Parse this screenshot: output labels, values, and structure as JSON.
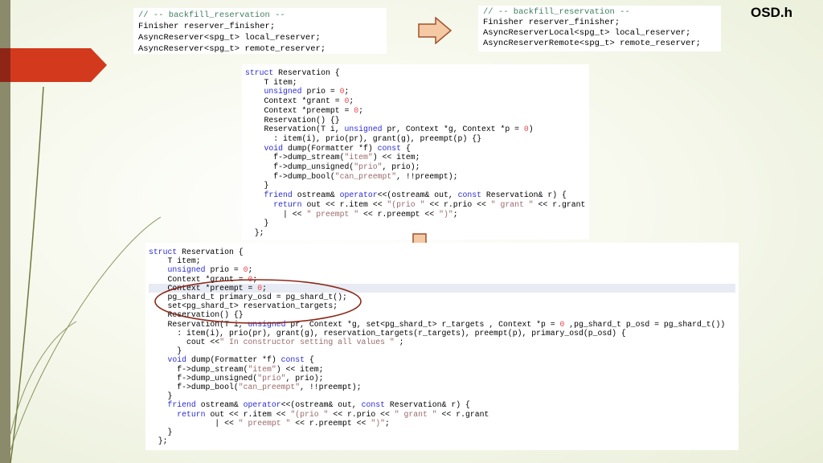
{
  "slide": {
    "title": "OSD.h"
  },
  "colors": {
    "comment": "#3f7f5f",
    "keyword": "#2a2ad4",
    "number": "#e8474a",
    "string": "#9a6a6a",
    "ribbon": "#d3391d",
    "ellipse": "#8b2a1a",
    "arrow_fill": "#f4c9a4",
    "arrow_stroke": "#a0522d"
  },
  "icons": {
    "right_arrow": "right-arrow-icon",
    "down_arrow": "down-arrow-icon"
  },
  "code_before": [
    [
      [
        "c",
        "// -- backfill_reservation --"
      ]
    ],
    [
      [
        "p",
        "Finisher reserver_finisher;"
      ]
    ],
    [
      [
        "p",
        "AsyncReserver<spg_t> local_reserver;"
      ]
    ],
    [
      [
        "p",
        "AsyncReserver<spg_t> remote_reserver;"
      ]
    ]
  ],
  "code_after": [
    [
      [
        "c",
        "// -- backfill_reservation --"
      ]
    ],
    [
      [
        "p",
        "Finisher reserver_finisher;"
      ]
    ],
    [
      [
        "p",
        "AsyncReserverLocal<spg_t> local_reserver;"
      ]
    ],
    [
      [
        "p",
        "AsyncReserverRemote<spg_t> remote_reserver;"
      ]
    ]
  ],
  "code_struct_original": [
    [
      [
        "k",
        "struct"
      ],
      [
        "p",
        " Reservation {"
      ]
    ],
    [
      [
        "p",
        "    T item;"
      ]
    ],
    [
      [
        "p",
        "    "
      ],
      [
        "k",
        "unsigned"
      ],
      [
        "p",
        " prio = "
      ],
      [
        "n",
        "0"
      ],
      [
        "p",
        ";"
      ]
    ],
    [
      [
        "p",
        "    Context *grant = "
      ],
      [
        "n",
        "0"
      ],
      [
        "p",
        ";"
      ]
    ],
    [
      [
        "p",
        "    Context *preempt = "
      ],
      [
        "n",
        "0"
      ],
      [
        "p",
        ";"
      ]
    ],
    [
      [
        "p",
        "    Reservation() {}"
      ]
    ],
    [
      [
        "p",
        "    Reservation(T i, "
      ],
      [
        "k",
        "unsigned"
      ],
      [
        "p",
        " pr, Context *g, Context *p = "
      ],
      [
        "n",
        "0"
      ],
      [
        "p",
        ")"
      ]
    ],
    [
      [
        "p",
        "      : item(i), prio(pr), grant(g), preempt(p) {}"
      ]
    ],
    [
      [
        "p",
        "    "
      ],
      [
        "k",
        "void"
      ],
      [
        "p",
        " dump(Formatter *f) "
      ],
      [
        "k",
        "const"
      ],
      [
        "p",
        " {"
      ]
    ],
    [
      [
        "p",
        "      f->dump_stream("
      ],
      [
        "s",
        "\"item\""
      ],
      [
        "p",
        ") << item;"
      ]
    ],
    [
      [
        "p",
        "      f->dump_unsigned("
      ],
      [
        "s",
        "\"prio\""
      ],
      [
        "p",
        ", prio);"
      ]
    ],
    [
      [
        "p",
        "      f->dump_bool("
      ],
      [
        "s",
        "\"can_preempt\""
      ],
      [
        "p",
        ", !!preempt);"
      ]
    ],
    [
      [
        "p",
        "    }"
      ]
    ],
    [
      [
        "p",
        "    "
      ],
      [
        "k",
        "friend"
      ],
      [
        "p",
        " ostream& "
      ],
      [
        "k",
        "operator"
      ],
      [
        "p",
        "<<(ostream& out, "
      ],
      [
        "k",
        "const"
      ],
      [
        "p",
        " Reservation& r) {"
      ]
    ],
    [
      [
        "p",
        "      "
      ],
      [
        "k",
        "return"
      ],
      [
        "p",
        " out << r.item << "
      ],
      [
        "s",
        "\"(prio \""
      ],
      [
        "p",
        " << r.prio << "
      ],
      [
        "s",
        "\" grant \""
      ],
      [
        "p",
        " << r.grant"
      ]
    ],
    [
      [
        "p",
        "        | << "
      ],
      [
        "s",
        "\" preempt \""
      ],
      [
        "p",
        " << r.preempt << "
      ],
      [
        "s",
        "\")\""
      ],
      [
        "p",
        ";"
      ]
    ],
    [
      [
        "p",
        "    }"
      ]
    ],
    [
      [
        "p",
        "  };"
      ]
    ]
  ],
  "code_struct_modified": [
    [
      [
        "k",
        "struct"
      ],
      [
        "p",
        " Reservation {"
      ]
    ],
    [
      [
        "p",
        "    T item;"
      ]
    ],
    [
      [
        "p",
        "    "
      ],
      [
        "k",
        "unsigned"
      ],
      [
        "p",
        " prio = "
      ],
      [
        "n",
        "0"
      ],
      [
        "p",
        ";"
      ]
    ],
    [
      [
        "p",
        "    Context *grant = "
      ],
      [
        "n",
        "0"
      ],
      [
        "p",
        ";"
      ]
    ],
    [
      [
        "p",
        "    Context *preempt = "
      ],
      [
        "n",
        "0"
      ],
      [
        "p",
        ";"
      ]
    ],
    [
      [
        "p",
        "    pg_shard_t primary_osd = pg_shard_t();"
      ]
    ],
    [
      [
        "p",
        "    set<pg_shard_t> reservation_targets;"
      ]
    ],
    [
      [
        "p",
        "    Reservation() {}"
      ]
    ],
    [
      [
        "p",
        "    Reservation(T i, "
      ],
      [
        "k",
        "unsigned"
      ],
      [
        "p",
        " pr, Context *g, set<pg_shard_t> r_targets , Context *p = "
      ],
      [
        "n",
        "0"
      ],
      [
        "p",
        " ,pg_shard_t p_osd = pg_shard_t())"
      ]
    ],
    [
      [
        "p",
        "      : item(i), prio(pr), grant(g), reservation_targets(r_targets), preempt(p), primary_osd(p_osd) {"
      ]
    ],
    [
      [
        "p",
        "        cout <<"
      ],
      [
        "s",
        "\" In constructor setting all values \""
      ],
      [
        "p",
        " ;"
      ]
    ],
    [
      [
        "p",
        "      }"
      ]
    ],
    [
      [
        "p",
        "    "
      ],
      [
        "k",
        "void"
      ],
      [
        "p",
        " dump(Formatter *f) "
      ],
      [
        "k",
        "const"
      ],
      [
        "p",
        " {"
      ]
    ],
    [
      [
        "p",
        "      f->dump_stream("
      ],
      [
        "s",
        "\"item\""
      ],
      [
        "p",
        ") << item;"
      ]
    ],
    [
      [
        "p",
        "      f->dump_unsigned("
      ],
      [
        "s",
        "\"prio\""
      ],
      [
        "p",
        ", prio);"
      ]
    ],
    [
      [
        "p",
        "      f->dump_bool("
      ],
      [
        "s",
        "\"can_preempt\""
      ],
      [
        "p",
        ", !!preempt);"
      ]
    ],
    [
      [
        "p",
        "    }"
      ]
    ],
    [
      [
        "p",
        "    "
      ],
      [
        "k",
        "friend"
      ],
      [
        "p",
        " ostream& "
      ],
      [
        "k",
        "operator"
      ],
      [
        "p",
        "<<(ostream& out, "
      ],
      [
        "k",
        "const"
      ],
      [
        "p",
        " Reservation& r) {"
      ]
    ],
    [
      [
        "p",
        "      "
      ],
      [
        "k",
        "return"
      ],
      [
        "p",
        " out << r.item << "
      ],
      [
        "s",
        "\"(prio \""
      ],
      [
        "p",
        " << r.prio << "
      ],
      [
        "s",
        "\" grant \""
      ],
      [
        "p",
        " << r.grant"
      ]
    ],
    [
      [
        "p",
        "              | << "
      ],
      [
        "s",
        "\" preempt \""
      ],
      [
        "p",
        " << r.preempt << "
      ],
      [
        "s",
        "\")\""
      ],
      [
        "p",
        ";"
      ]
    ],
    [
      [
        "p",
        "    }"
      ]
    ],
    [
      [
        "p",
        "  };"
      ]
    ]
  ]
}
